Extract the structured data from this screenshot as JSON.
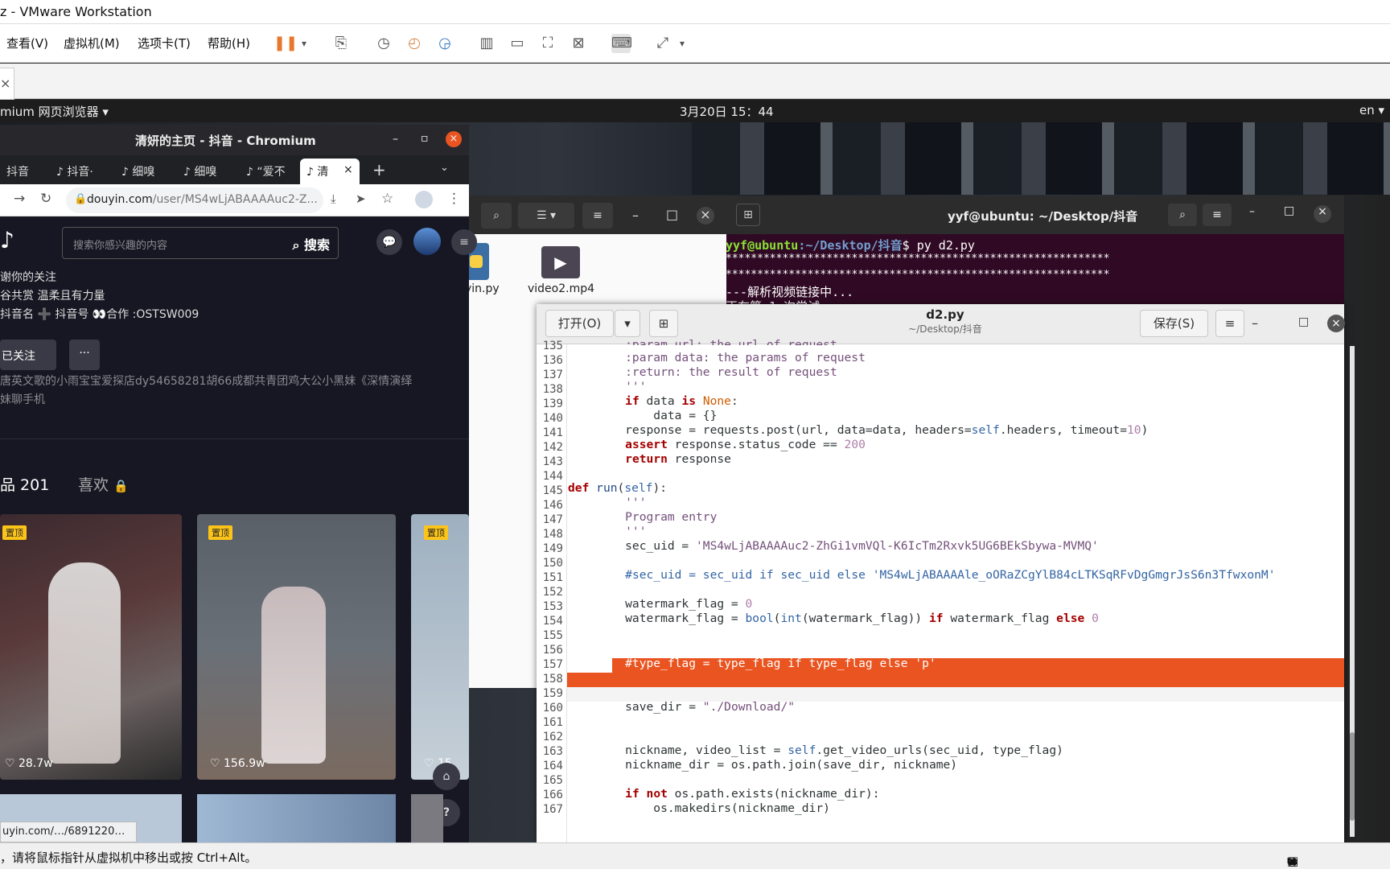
{
  "vmware": {
    "title": "z - VMware Workstation",
    "menu": [
      "查看(V)",
      "虚拟机(M)",
      "选项卡(T)",
      "帮助(H)"
    ],
    "status": "，请将鼠标指针从虚拟机中移出或按 Ctrl+Alt。",
    "tab_close": "×"
  },
  "ubuntu": {
    "app_menu": "mium 网页浏览器 ▾",
    "clock": "3月20日 15：44",
    "lang": "en ▾"
  },
  "chromium": {
    "title": "清妍的主页 - 抖音 - Chromium",
    "tabs": [
      "抖音",
      "抖音·",
      "细嗅",
      "细嗅",
      "“爱不",
      "清"
    ],
    "url_domain": "douyin.com",
    "url_path": "/user/MS4wLjABAAAAuc2-Z...",
    "hover_url": "uyin.com/…/6891220…"
  },
  "douyin": {
    "search_placeholder": "搜索你感兴趣的内容",
    "search_button": "搜索",
    "bio_lines": [
      "谢你的关注",
      "谷共赏 温柔且有力量",
      "抖音名 ➕ 抖音号 👀合作 :OSTSW009"
    ],
    "follow_label": "已关注",
    "more_label": "···",
    "music_line1": "唐英文歌的小雨宝宝爱探店dy54658281胡66成都共青团鸡大公小黑妹《深情演绎",
    "music_line2": "妹聊手机",
    "tab_works": "品 201",
    "tab_likes": "喜欢",
    "pinned_label": "置顶",
    "videos": [
      {
        "likes": "28.7w"
      },
      {
        "likes": "156.9w"
      },
      {
        "likes": "15."
      }
    ]
  },
  "files": {
    "file1": "yin.py",
    "file2": "video2.mp4"
  },
  "terminal": {
    "title": "yyf@ubuntu: ~/Desktop/抖音",
    "prompt_user": "yyf@ubuntu",
    "prompt_path": ":~/Desktop/抖音",
    "command": "$ py d2.py",
    "stars": "*************************************************************",
    "line3": "---解析视频链接中...",
    "line4": "   正在第 1 次尝试"
  },
  "gedit": {
    "open_label": "打开(O)",
    "save_label": "保存(S)",
    "filename": "d2.py",
    "path": "~/Desktop/抖音",
    "line_numbers": [
      "135",
      "136",
      "137",
      "138",
      "139",
      "140",
      "141",
      "142",
      "143",
      "144",
      "145",
      "146",
      "147",
      "148",
      "149",
      "150",
      "151",
      "152",
      "153",
      "154",
      "155",
      "156",
      "157",
      "158",
      "159",
      "160",
      "161",
      "162",
      "163",
      "164",
      "165",
      "166",
      "167"
    ]
  },
  "colors": {
    "selection": "#e95420",
    "terminal_bg": "#300a24",
    "douyin_bg": "#161722"
  }
}
